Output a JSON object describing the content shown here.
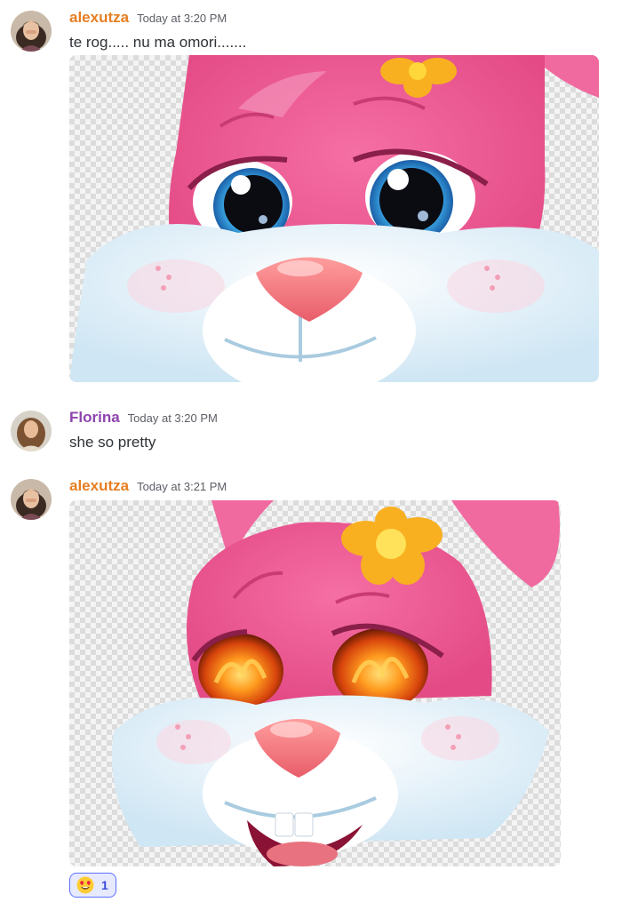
{
  "messages": [
    {
      "author": "alexutza",
      "time": "Today at 3:20 PM",
      "text": "te rog..... nu ma omori......."
    },
    {
      "author": "Florina",
      "time": "Today at 3:20 PM",
      "text": "she so pretty"
    },
    {
      "author": "alexutza",
      "time": "Today at 3:21 PM"
    }
  ],
  "reaction": {
    "emoji": "heart-eyes",
    "count": "1"
  },
  "colors": {
    "alexutza": "#e67e22",
    "florina": "#8e44ad",
    "reaction_border": "#5b70ff"
  }
}
